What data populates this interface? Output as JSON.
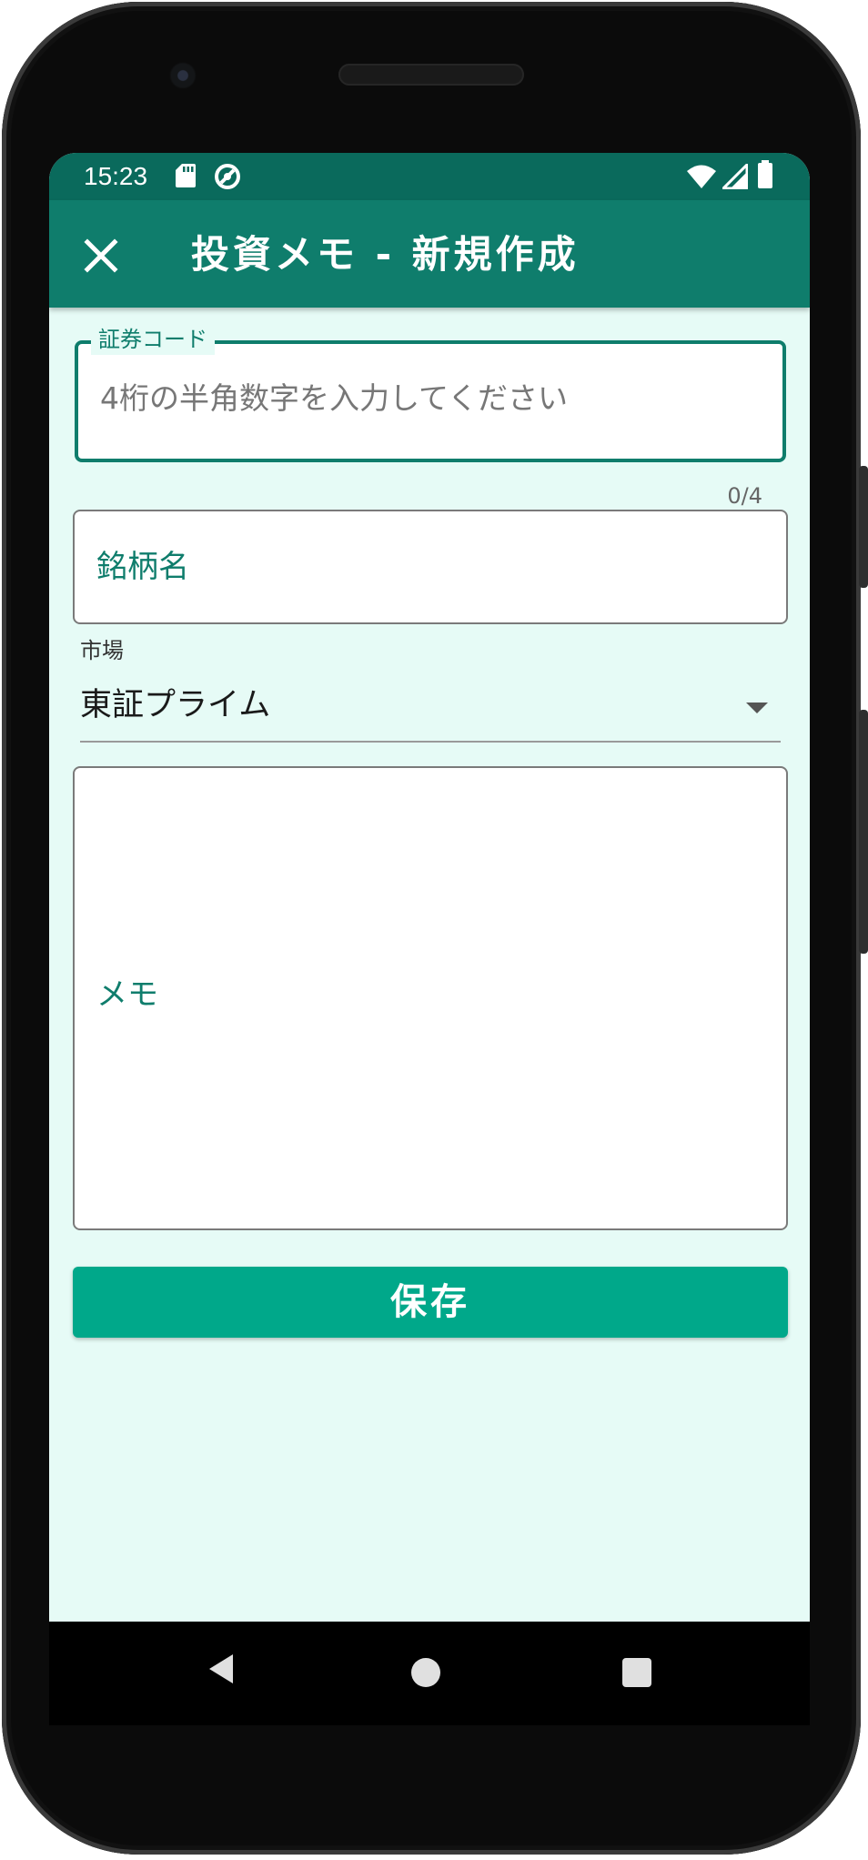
{
  "status_bar": {
    "time": "15:23",
    "left_icons": [
      "sd-card-icon",
      "data-saver-icon"
    ],
    "right_icons": [
      "wifi-icon",
      "cellular-signal-icon",
      "battery-icon"
    ]
  },
  "app_bar": {
    "title": "投資メモ - 新規作成",
    "close_icon": "close-icon"
  },
  "form": {
    "code": {
      "label": "証券コード",
      "placeholder": "4桁の半角数字を入力してください",
      "value": "",
      "counter": "0/4"
    },
    "name": {
      "label": "銘柄名",
      "value": ""
    },
    "market": {
      "caption": "市場",
      "selected": "東証プライム"
    },
    "memo": {
      "label": "メモ",
      "value": ""
    },
    "save_label": "保存"
  },
  "nav": {
    "back_icon": "back-triangle-icon",
    "home_icon": "home-circle-icon",
    "recents_icon": "recents-square-icon"
  },
  "colors": {
    "status_bar": "#0a6a5c",
    "app_bar": "#0f7d6c",
    "background": "#e6fbf6",
    "accent": "#0f7d6c",
    "button": "#00a88a"
  }
}
